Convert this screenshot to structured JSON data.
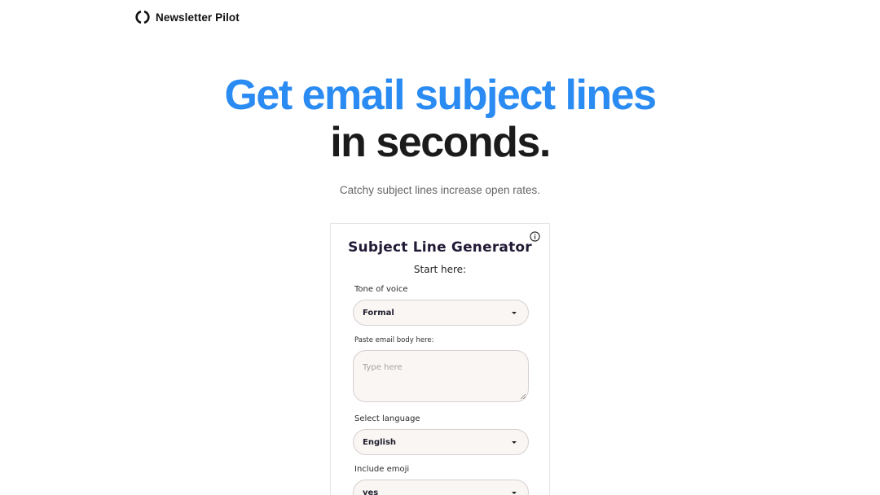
{
  "header": {
    "brand_name": "Newsletter Pilot",
    "logo_icon": "bracket-circle-icon"
  },
  "hero": {
    "line1": "Get email subject lines",
    "line2": "in seconds.",
    "subtitle": "Catchy subject lines increase open rates.",
    "accent_color": "#2a8bf2"
  },
  "card": {
    "title": "Subject Line Generator",
    "subtitle": "Start here:",
    "info_icon": "info-icon",
    "tone": {
      "label": "Tone of voice",
      "value": "Formal"
    },
    "email_body": {
      "label": "Paste email body here:",
      "placeholder": "Type here"
    },
    "language": {
      "label": "Select language",
      "value": "English"
    },
    "emoji": {
      "label": "Include emoji",
      "value": "yes"
    }
  }
}
